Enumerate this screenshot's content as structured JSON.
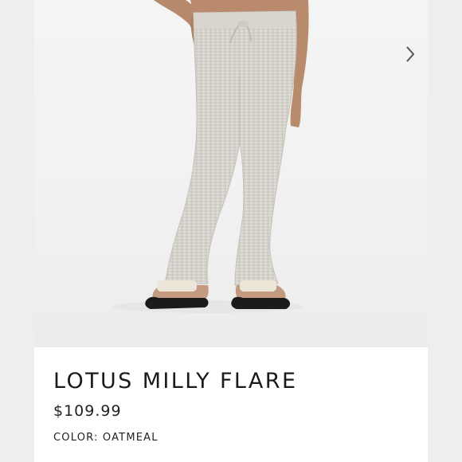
{
  "product": {
    "title": "LOTUS MILLY FLARE",
    "price": "$109.99",
    "color_label": "COLOR:",
    "color_value": "OATMEAL"
  },
  "gallery": {
    "prev_icon": "chevron-left-icon",
    "next_icon": "chevron-right-icon"
  },
  "colors": {
    "background": "#eeeeee",
    "card": "#ffffff",
    "pants": "#d9d6d0",
    "text": "#1a1a1a",
    "arrow": "#555555"
  }
}
